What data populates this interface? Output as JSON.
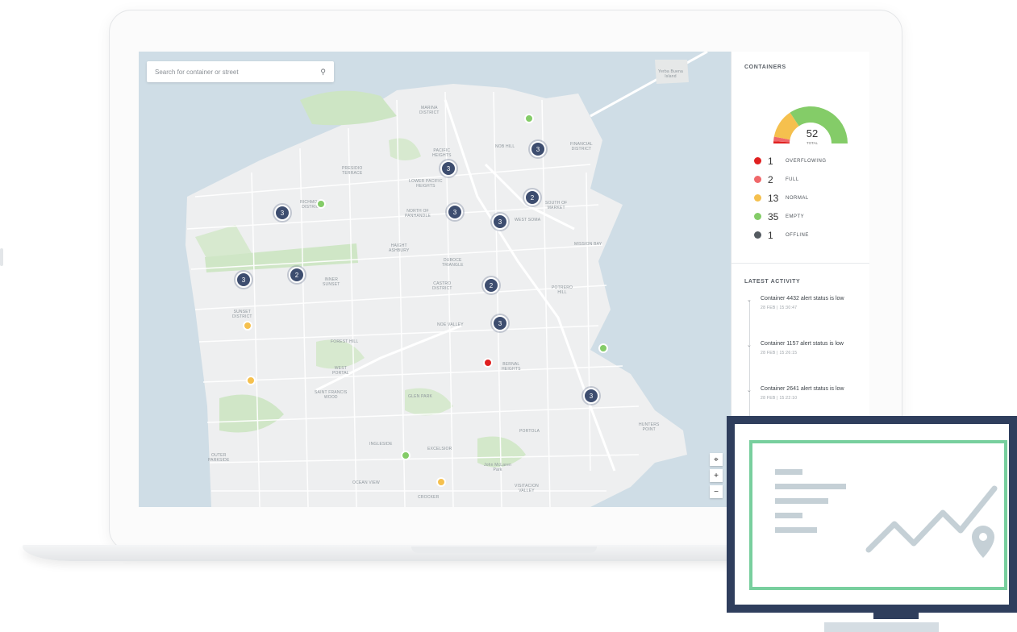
{
  "search": {
    "placeholder": "Search for container or street"
  },
  "map": {
    "clusters": [
      "3",
      "3",
      "2",
      "3",
      "3",
      "3",
      "3",
      "2",
      "2",
      "3",
      "3",
      "2"
    ],
    "labels": {
      "marina": "MARINA\nDISTRICT",
      "nobhill": "NOB HILL",
      "financial": "FINANCIAL\nDISTRICT",
      "pacific": "PACIFIC\nHEIGHTS",
      "lowerpac": "LOWER PACIFIC\nHEIGHTS",
      "presidio": "PRESIDIO\nTERRACE",
      "richmond": "RICHMOND\nDISTRICT",
      "northpan": "NORTH OF\nPANHANDLE",
      "westsoma": "WEST SOMA",
      "southmarket": "SOUTH OF\nMARKET",
      "haight": "HAIGHT\nASHBURY",
      "duboce": "DUBOCE\nTRIANGLE",
      "innersunset": "INNER\nSUNSET",
      "castro": "CASTRO\nDISTRICT",
      "potrero": "POTRERO\nHILL",
      "noe": "NOE VALLEY",
      "forest": "FOREST HILL",
      "westportal": "WEST\nPORTAL",
      "stfrancis": "SAINT FRANCIS\nWOOD",
      "glenpark": "GLEN PARK",
      "bernal": "BERNAL\nHEIGHTS",
      "portola": "PORTOLA",
      "ingleside": "INGLESIDE",
      "excelsior": "EXCELSIOR",
      "oceanview": "OCEAN VIEW",
      "crocker": "CROCKER",
      "visitacion": "VISITACION\nVALLEY",
      "hunters": "HUNTERS\nPOINT",
      "mission": "MISSION BAY",
      "sunset": "SUNSET\nDISTRICT",
      "outer": "OUTER\nPARKSIDE",
      "yerba": "Yerba Buena\nIsland",
      "mclaren": "John McLaren\nPark"
    }
  },
  "panel": {
    "title": "CONTAINERS",
    "gauge": {
      "total": "52",
      "total_label": "TOTAL",
      "segments": [
        1,
        2,
        13,
        35
      ]
    },
    "legend": [
      {
        "count": "1",
        "label": "OVERFLOWING",
        "color": "#e02020"
      },
      {
        "count": "2",
        "label": "FULL",
        "color": "#f0686a"
      },
      {
        "count": "13",
        "label": "NORMAL",
        "color": "#f5c04e"
      },
      {
        "count": "35",
        "label": "EMPTY",
        "color": "#84cc68"
      },
      {
        "count": "1",
        "label": "OFFLINE",
        "color": "#555b61"
      }
    ],
    "activity_title": "LATEST ACTIVITY",
    "activity": [
      {
        "text": "Container 4432 alert status is low",
        "time": "28 FEB | 15:30:47"
      },
      {
        "text": "Container 1157 alert status is low",
        "time": "28 FEB | 15:26:15"
      },
      {
        "text": "Container 2641 alert status is low",
        "time": "28 FEB | 15:22:10"
      }
    ]
  },
  "colors": {
    "cluster": "#3d4d6f",
    "monitor_frame": "#2f3e5d",
    "monitor_accent": "#78cf9e"
  }
}
